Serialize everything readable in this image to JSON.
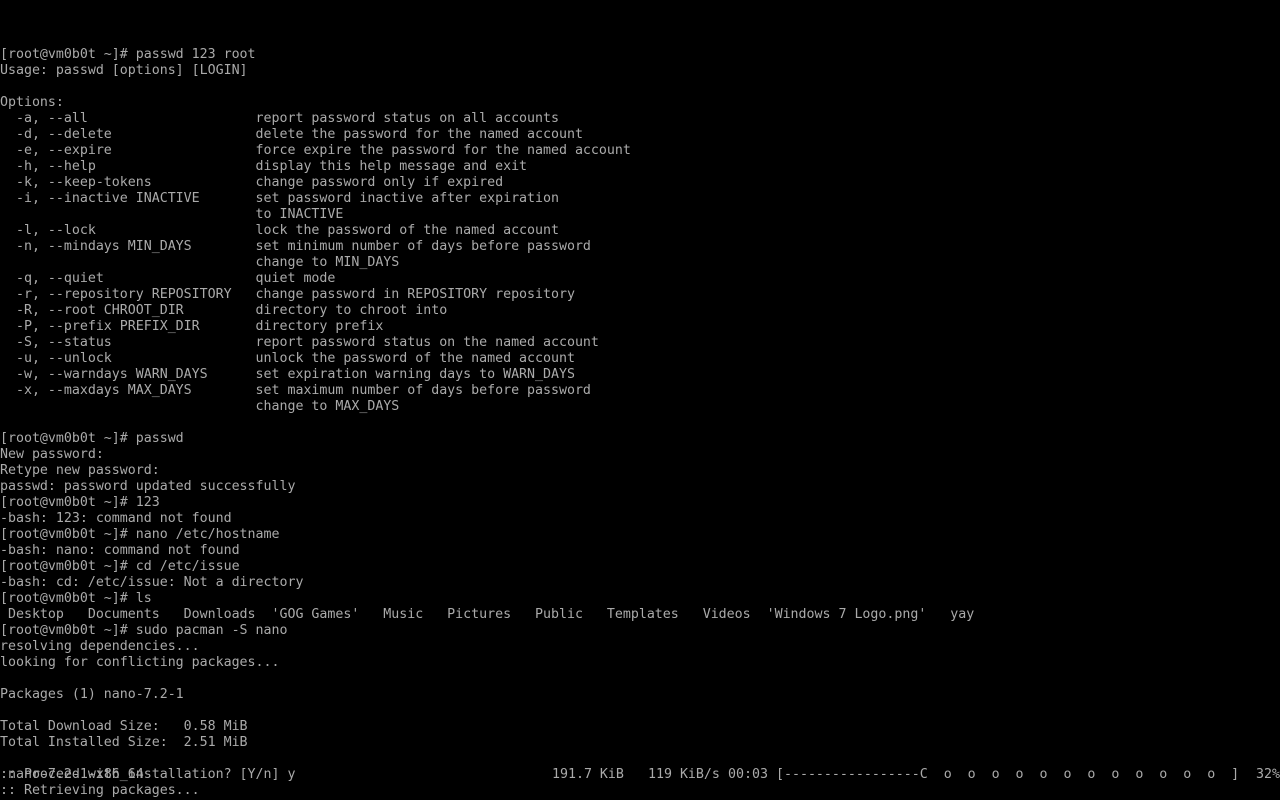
{
  "terminal": {
    "fg_color": "#aaaaaa",
    "bg_color": "#000000",
    "lines": [
      "[root@vm0b0t ~]# passwd 123 root",
      "Usage: passwd [options] [LOGIN]",
      "",
      "Options:",
      "  -a, --all                     report password status on all accounts",
      "  -d, --delete                  delete the password for the named account",
      "  -e, --expire                  force expire the password for the named account",
      "  -h, --help                    display this help message and exit",
      "  -k, --keep-tokens             change password only if expired",
      "  -i, --inactive INACTIVE       set password inactive after expiration",
      "                                to INACTIVE",
      "  -l, --lock                    lock the password of the named account",
      "  -n, --mindays MIN_DAYS        set minimum number of days before password",
      "                                change to MIN_DAYS",
      "  -q, --quiet                   quiet mode",
      "  -r, --repository REPOSITORY   change password in REPOSITORY repository",
      "  -R, --root CHROOT_DIR         directory to chroot into",
      "  -P, --prefix PREFIX_DIR       directory prefix",
      "  -S, --status                  report password status on the named account",
      "  -u, --unlock                  unlock the password of the named account",
      "  -w, --warndays WARN_DAYS      set expiration warning days to WARN_DAYS",
      "  -x, --maxdays MAX_DAYS        set maximum number of days before password",
      "                                change to MAX_DAYS",
      "",
      "[root@vm0b0t ~]# passwd",
      "New password:",
      "Retype new password:",
      "passwd: password updated successfully",
      "[root@vm0b0t ~]# 123",
      "-bash: 123: command not found",
      "[root@vm0b0t ~]# nano /etc/hostname",
      "-bash: nano: command not found",
      "[root@vm0b0t ~]# cd /etc/issue",
      "-bash: cd: /etc/issue: Not a directory",
      "[root@vm0b0t ~]# ls",
      " Desktop   Documents   Downloads  'GOG Games'   Music   Pictures   Public   Templates   Videos  'Windows 7 Logo.png'   yay",
      "[root@vm0b0t ~]# sudo pacman -S nano",
      "resolving dependencies...",
      "looking for conflicting packages...",
      "",
      "Packages (1) nano-7.2-1",
      "",
      "Total Download Size:   0.58 MiB",
      "Total Installed Size:  2.51 MiB",
      "",
      ":: Proceed with installation? [Y/n] y",
      ":: Retrieving packages..."
    ],
    "progress": {
      "package": "nano-7.2-1-x86_64",
      "downloaded": "191.7 KiB",
      "rate": "119 KiB/s",
      "eta": "00:03",
      "bar": "[-----------------C  o  o  o  o  o  o  o  o  o  o  o  o  ]",
      "percent": "32%"
    }
  }
}
